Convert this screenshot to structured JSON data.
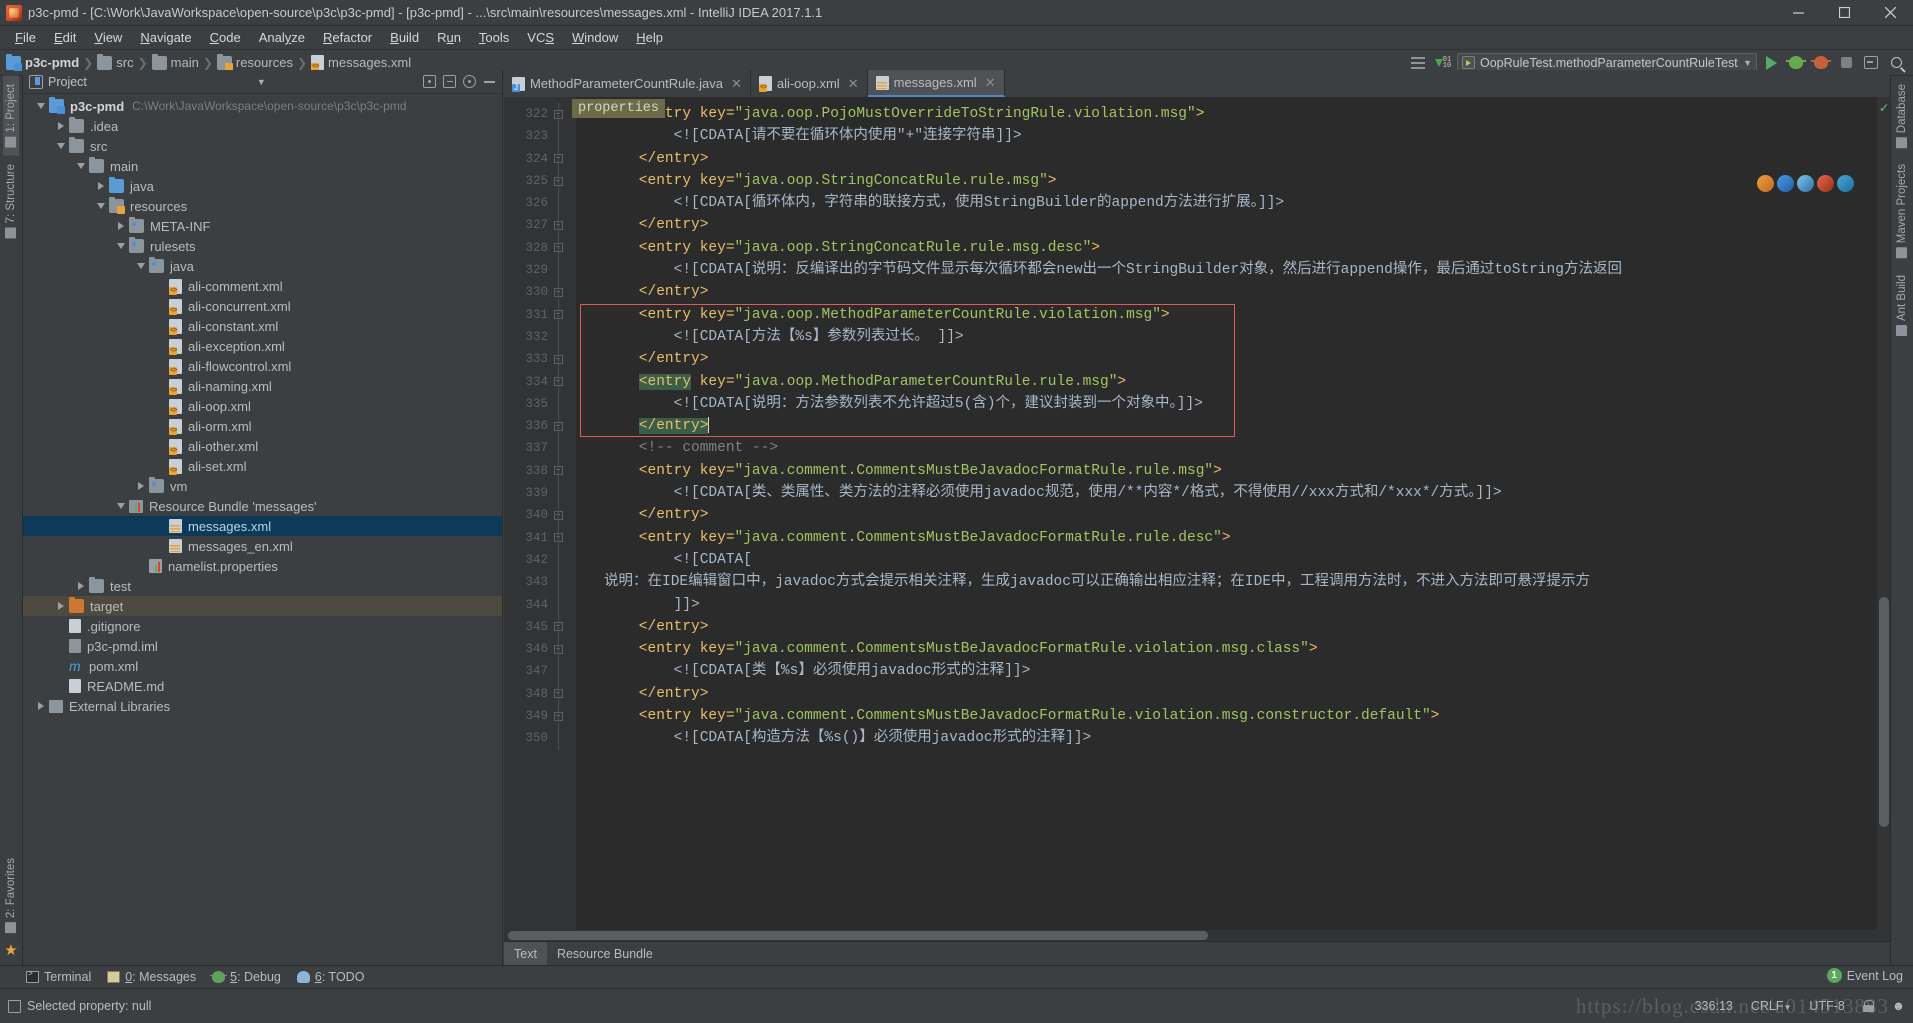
{
  "window": {
    "title": "p3c-pmd - [C:\\Work\\JavaWorkspace\\open-source\\p3c\\p3c-pmd] - [p3c-pmd] - ...\\src\\main\\resources\\messages.xml - IntelliJ IDEA 2017.1.1",
    "minimize_label": "Minimize",
    "maximize_label": "Maximize",
    "close_label": "Close"
  },
  "menubar": {
    "items": [
      {
        "label": "File",
        "accel": "F"
      },
      {
        "label": "Edit",
        "accel": "E"
      },
      {
        "label": "View",
        "accel": "V"
      },
      {
        "label": "Navigate",
        "accel": "N"
      },
      {
        "label": "Code",
        "accel": "C"
      },
      {
        "label": "Analyze",
        "accel": "y"
      },
      {
        "label": "Refactor",
        "accel": "R"
      },
      {
        "label": "Build",
        "accel": "B"
      },
      {
        "label": "Run",
        "accel": "u"
      },
      {
        "label": "Tools",
        "accel": "T"
      },
      {
        "label": "VCS",
        "accel": "S"
      },
      {
        "label": "Window",
        "accel": "W"
      },
      {
        "label": "Help",
        "accel": "H"
      }
    ]
  },
  "navbar": {
    "breadcrumb": [
      {
        "label": "p3c-pmd",
        "icon": "module-folder-icon"
      },
      {
        "label": "src",
        "icon": "folder-icon"
      },
      {
        "label": "main",
        "icon": "folder-icon"
      },
      {
        "label": "resources",
        "icon": "resources-folder-icon"
      },
      {
        "label": "messages.xml",
        "icon": "xml-file-icon"
      }
    ],
    "run_config": "OopRuleTest.methodParameterCountRuleTest",
    "buttons": [
      "run-button",
      "debug-button",
      "coverage-button",
      "stop-button",
      "layout-button",
      "search-button"
    ]
  },
  "left_strip": {
    "tabs": [
      {
        "label": "1: Project",
        "active": true
      },
      {
        "label": "7: Structure",
        "active": false
      },
      {
        "label": "2: Favorites",
        "active": false
      }
    ]
  },
  "right_strip": {
    "tabs": [
      {
        "label": "Database"
      },
      {
        "label": "Maven Projects"
      },
      {
        "label": "Ant Build"
      }
    ]
  },
  "project_panel": {
    "title": "Project",
    "tree": [
      {
        "depth": 0,
        "label": "p3c-pmd",
        "path": "C:\\Work\\JavaWorkspace\\open-source\\p3c\\p3c-pmd",
        "twist": "down",
        "icon": "module-folder-icon",
        "bold": true
      },
      {
        "depth": 1,
        "label": ".idea",
        "twist": "right",
        "icon": "folder-icon"
      },
      {
        "depth": 1,
        "label": "src",
        "twist": "down",
        "icon": "folder-icon"
      },
      {
        "depth": 2,
        "label": "main",
        "twist": "down",
        "icon": "folder-icon"
      },
      {
        "depth": 3,
        "label": "java",
        "twist": "right",
        "icon": "source-folder-icon"
      },
      {
        "depth": 3,
        "label": "resources",
        "twist": "down",
        "icon": "resources-folder-icon"
      },
      {
        "depth": 4,
        "label": "META-INF",
        "twist": "right",
        "icon": "package-folder-icon"
      },
      {
        "depth": 4,
        "label": "rulesets",
        "twist": "down",
        "icon": "package-folder-icon"
      },
      {
        "depth": 5,
        "label": "java",
        "twist": "down",
        "icon": "package-folder-icon"
      },
      {
        "depth": 6,
        "label": "ali-comment.xml",
        "twist": "none",
        "icon": "xml-file-icon"
      },
      {
        "depth": 6,
        "label": "ali-concurrent.xml",
        "twist": "none",
        "icon": "xml-file-icon"
      },
      {
        "depth": 6,
        "label": "ali-constant.xml",
        "twist": "none",
        "icon": "xml-file-icon"
      },
      {
        "depth": 6,
        "label": "ali-exception.xml",
        "twist": "none",
        "icon": "xml-file-icon"
      },
      {
        "depth": 6,
        "label": "ali-flowcontrol.xml",
        "twist": "none",
        "icon": "xml-file-icon"
      },
      {
        "depth": 6,
        "label": "ali-naming.xml",
        "twist": "none",
        "icon": "xml-file-icon"
      },
      {
        "depth": 6,
        "label": "ali-oop.xml",
        "twist": "none",
        "icon": "xml-file-icon"
      },
      {
        "depth": 6,
        "label": "ali-orm.xml",
        "twist": "none",
        "icon": "xml-file-icon"
      },
      {
        "depth": 6,
        "label": "ali-other.xml",
        "twist": "none",
        "icon": "xml-file-icon"
      },
      {
        "depth": 6,
        "label": "ali-set.xml",
        "twist": "none",
        "icon": "xml-file-icon"
      },
      {
        "depth": 5,
        "label": "vm",
        "twist": "right",
        "icon": "package-folder-icon"
      },
      {
        "depth": 4,
        "label": "Resource Bundle 'messages'",
        "twist": "down",
        "icon": "resource-bundle-icon"
      },
      {
        "depth": 6,
        "label": "messages.xml",
        "twist": "none",
        "icon": "properties-xml-icon",
        "selected": true
      },
      {
        "depth": 6,
        "label": "messages_en.xml",
        "twist": "none",
        "icon": "properties-xml-icon"
      },
      {
        "depth": 5,
        "label": "namelist.properties",
        "twist": "none",
        "icon": "properties-icon"
      },
      {
        "depth": 2,
        "label": "test",
        "twist": "right",
        "icon": "folder-icon"
      },
      {
        "depth": 1,
        "label": "target",
        "twist": "right",
        "icon": "excluded-folder-icon",
        "highlight": true
      },
      {
        "depth": 1,
        "label": ".gitignore",
        "twist": "none",
        "icon": "text-file-icon"
      },
      {
        "depth": 1,
        "label": "p3c-pmd.iml",
        "twist": "none",
        "icon": "iml-file-icon"
      },
      {
        "depth": 1,
        "label": "pom.xml",
        "twist": "none",
        "icon": "maven-icon"
      },
      {
        "depth": 1,
        "label": "README.md",
        "twist": "none",
        "icon": "markdown-icon"
      },
      {
        "depth": 0,
        "label": "External Libraries",
        "twist": "right",
        "icon": "libraries-icon"
      }
    ]
  },
  "editor": {
    "tabs": [
      {
        "label": "MethodParameterCountRule.java",
        "icon": "java-file-icon",
        "active": false,
        "closable": true
      },
      {
        "label": "ali-oop.xml",
        "icon": "xml-file-icon",
        "active": false,
        "closable": true
      },
      {
        "label": "messages.xml",
        "icon": "properties-xml-icon",
        "active": true,
        "closable": true
      }
    ],
    "breadcrumb_badge": "properties",
    "first_line_number": 322,
    "lines": [
      {
        "n": 322,
        "fold": "collapse-start",
        "segments": [
          {
            "t": "    <entry key=",
            "c": "tag"
          },
          {
            "t": "\"java.oop.PojoMustOverrideToStringRule.violation.msg\"",
            "c": "attrval"
          },
          {
            "t": ">",
            "c": "tag"
          }
        ]
      },
      {
        "n": 323,
        "fold": "line",
        "segments": [
          {
            "t": "        <![CDATA[请不要在循环体内使用\"+\"连接字符串]]>",
            "c": "cdata"
          }
        ]
      },
      {
        "n": 324,
        "fold": "collapse-end",
        "segments": [
          {
            "t": "    </entry>",
            "c": "tag"
          }
        ]
      },
      {
        "n": 325,
        "fold": "collapse-start",
        "segments": [
          {
            "t": "    <entry key=",
            "c": "tag"
          },
          {
            "t": "\"java.oop.StringConcatRule.rule.msg\"",
            "c": "attrval"
          },
          {
            "t": ">",
            "c": "tag"
          }
        ]
      },
      {
        "n": 326,
        "fold": "line",
        "segments": [
          {
            "t": "        <![CDATA[循环体内，字符串的联接方式，使用StringBuilder的append方法进行扩展。]]>",
            "c": "cdata"
          }
        ]
      },
      {
        "n": 327,
        "fold": "collapse-end",
        "segments": [
          {
            "t": "    </entry>",
            "c": "tag"
          }
        ]
      },
      {
        "n": 328,
        "fold": "collapse-start",
        "segments": [
          {
            "t": "    <entry key=",
            "c": "tag"
          },
          {
            "t": "\"java.oop.StringConcatRule.rule.msg.desc\"",
            "c": "attrval"
          },
          {
            "t": ">",
            "c": "tag"
          }
        ]
      },
      {
        "n": 329,
        "fold": "line",
        "segments": [
          {
            "t": "        <![CDATA[说明：反编译出的字节码文件显示每次循环都会new出一个StringBuilder对象，然后进行append操作，最后通过toString方法返回",
            "c": "cdata"
          }
        ]
      },
      {
        "n": 330,
        "fold": "collapse-end",
        "segments": [
          {
            "t": "    </entry>",
            "c": "tag"
          }
        ]
      },
      {
        "n": 331,
        "fold": "collapse-start",
        "segments": [
          {
            "t": "    <entry key=",
            "c": "tag"
          },
          {
            "t": "\"java.oop.MethodParameterCountRule.violation.msg\"",
            "c": "attrval"
          },
          {
            "t": ">",
            "c": "tag"
          }
        ]
      },
      {
        "n": 332,
        "fold": "line",
        "segments": [
          {
            "t": "        <![CDATA[方法【%s】参数列表过长。 ]]>",
            "c": "cdata"
          }
        ]
      },
      {
        "n": 333,
        "fold": "collapse-end",
        "segments": [
          {
            "t": "    </entry>",
            "c": "tag"
          }
        ]
      },
      {
        "n": 334,
        "fold": "collapse-start",
        "segments": [
          {
            "t": "    ",
            "c": "tag"
          },
          {
            "t": "<entry",
            "c": "tag",
            "sel": "green"
          },
          {
            "t": " key=",
            "c": "tag"
          },
          {
            "t": "\"java.oop.MethodParameterCountRule.rule.msg\"",
            "c": "attrval"
          },
          {
            "t": ">",
            "c": "tag"
          }
        ]
      },
      {
        "n": 335,
        "fold": "line",
        "segments": [
          {
            "t": "        <![CDATA[说明：方法参数列表不允许超过5(含)个，建议封装到一个对象中。]]>",
            "c": "cdata"
          }
        ]
      },
      {
        "n": 336,
        "fold": "collapse-end",
        "bulb": true,
        "segments": [
          {
            "t": "    ",
            "c": "tag"
          },
          {
            "t": "</entry>",
            "c": "tag",
            "sel": "green"
          },
          {
            "t": "|",
            "c": "caret"
          }
        ]
      },
      {
        "n": 337,
        "fold": "none",
        "segments": [
          {
            "t": "    <!-- comment -->",
            "c": "comment"
          }
        ]
      },
      {
        "n": 338,
        "fold": "collapse-start",
        "segments": [
          {
            "t": "    <entry key=",
            "c": "tag"
          },
          {
            "t": "\"java.comment.CommentsMustBeJavadocFormatRule.rule.msg\"",
            "c": "attrval"
          },
          {
            "t": ">",
            "c": "tag"
          }
        ]
      },
      {
        "n": 339,
        "fold": "line",
        "segments": [
          {
            "t": "        <![CDATA[类、类属性、类方法的注释必须使用javadoc规范，使用/**内容*/格式，不得使用//xxx方式和/*xxx*/方式。]]>",
            "c": "cdata"
          }
        ]
      },
      {
        "n": 340,
        "fold": "collapse-end",
        "segments": [
          {
            "t": "    </entry>",
            "c": "tag"
          }
        ]
      },
      {
        "n": 341,
        "fold": "collapse-start",
        "segments": [
          {
            "t": "    <entry key=",
            "c": "tag"
          },
          {
            "t": "\"java.comment.CommentsMustBeJavadocFormatRule.rule.desc\"",
            "c": "attrval"
          },
          {
            "t": ">",
            "c": "tag"
          }
        ]
      },
      {
        "n": 342,
        "fold": "line",
        "segments": [
          {
            "t": "        <![CDATA[",
            "c": "cdata"
          }
        ]
      },
      {
        "n": 343,
        "fold": "none",
        "segments": [
          {
            "t": "说明：在IDE编辑窗口中，javadoc方式会提示相关注释，生成javadoc可以正确输出相应注释；在IDE中，工程调用方法时，不进入方法即可悬浮提示方",
            "c": "cdata"
          }
        ]
      },
      {
        "n": 344,
        "fold": "none",
        "segments": [
          {
            "t": "        ]]>",
            "c": "cdata"
          }
        ]
      },
      {
        "n": 345,
        "fold": "collapse-end",
        "segments": [
          {
            "t": "    </entry>",
            "c": "tag"
          }
        ]
      },
      {
        "n": 346,
        "fold": "collapse-start",
        "segments": [
          {
            "t": "    <entry key=",
            "c": "tag"
          },
          {
            "t": "\"java.comment.CommentsMustBeJavadocFormatRule.violation.msg.class\"",
            "c": "attrval"
          },
          {
            "t": ">",
            "c": "tag"
          }
        ]
      },
      {
        "n": 347,
        "fold": "line",
        "segments": [
          {
            "t": "        <![CDATA[类【%s】必须使用javadoc形式的注释]]>",
            "c": "cdata"
          }
        ]
      },
      {
        "n": 348,
        "fold": "collapse-end",
        "segments": [
          {
            "t": "    </entry>",
            "c": "tag"
          }
        ]
      },
      {
        "n": 349,
        "fold": "collapse-start",
        "segments": [
          {
            "t": "    <entry key=",
            "c": "tag"
          },
          {
            "t": "\"java.comment.CommentsMustBeJavadocFormatRule.violation.msg.constructor.default\"",
            "c": "attrval"
          },
          {
            "t": ">",
            "c": "tag"
          }
        ]
      },
      {
        "n": 350,
        "fold": "line",
        "segments": [
          {
            "t": "        <![CDATA[构造方法【%s()】必须使用javadoc形式的注释]]>",
            "c": "cdata"
          }
        ]
      }
    ],
    "bottom_tabs": [
      {
        "label": "Text",
        "active": true
      },
      {
        "label": "Resource Bundle",
        "active": false
      }
    ]
  },
  "tool_window_bar": {
    "buttons": [
      {
        "label": "Terminal",
        "accel": "",
        "icon": "terminal-icon"
      },
      {
        "label": "0: Messages",
        "accel": "0",
        "icon": "messages-icon"
      },
      {
        "label": "5: Debug",
        "accel": "5",
        "icon": "debug-icon"
      },
      {
        "label": "6: TODO",
        "accel": "6",
        "icon": "todo-icon"
      }
    ]
  },
  "status_bar": {
    "message": "Selected property: null",
    "caret_position": "336:13",
    "line_separator": "CRLF",
    "encoding": "UTF-8",
    "event_log_label": "Event Log",
    "event_log_count": "1"
  },
  "watermark": "https://blog.csdn.net/u014513883",
  "colors": {
    "accent": "#4a88c7",
    "selection": "#0d3a58",
    "error_box": "#e05a5a",
    "tag": "#e8bf6a",
    "string": "#a5c261",
    "text": "#a9b7c6",
    "background": "#2b2b2b",
    "chrome": "#3c3f41"
  }
}
